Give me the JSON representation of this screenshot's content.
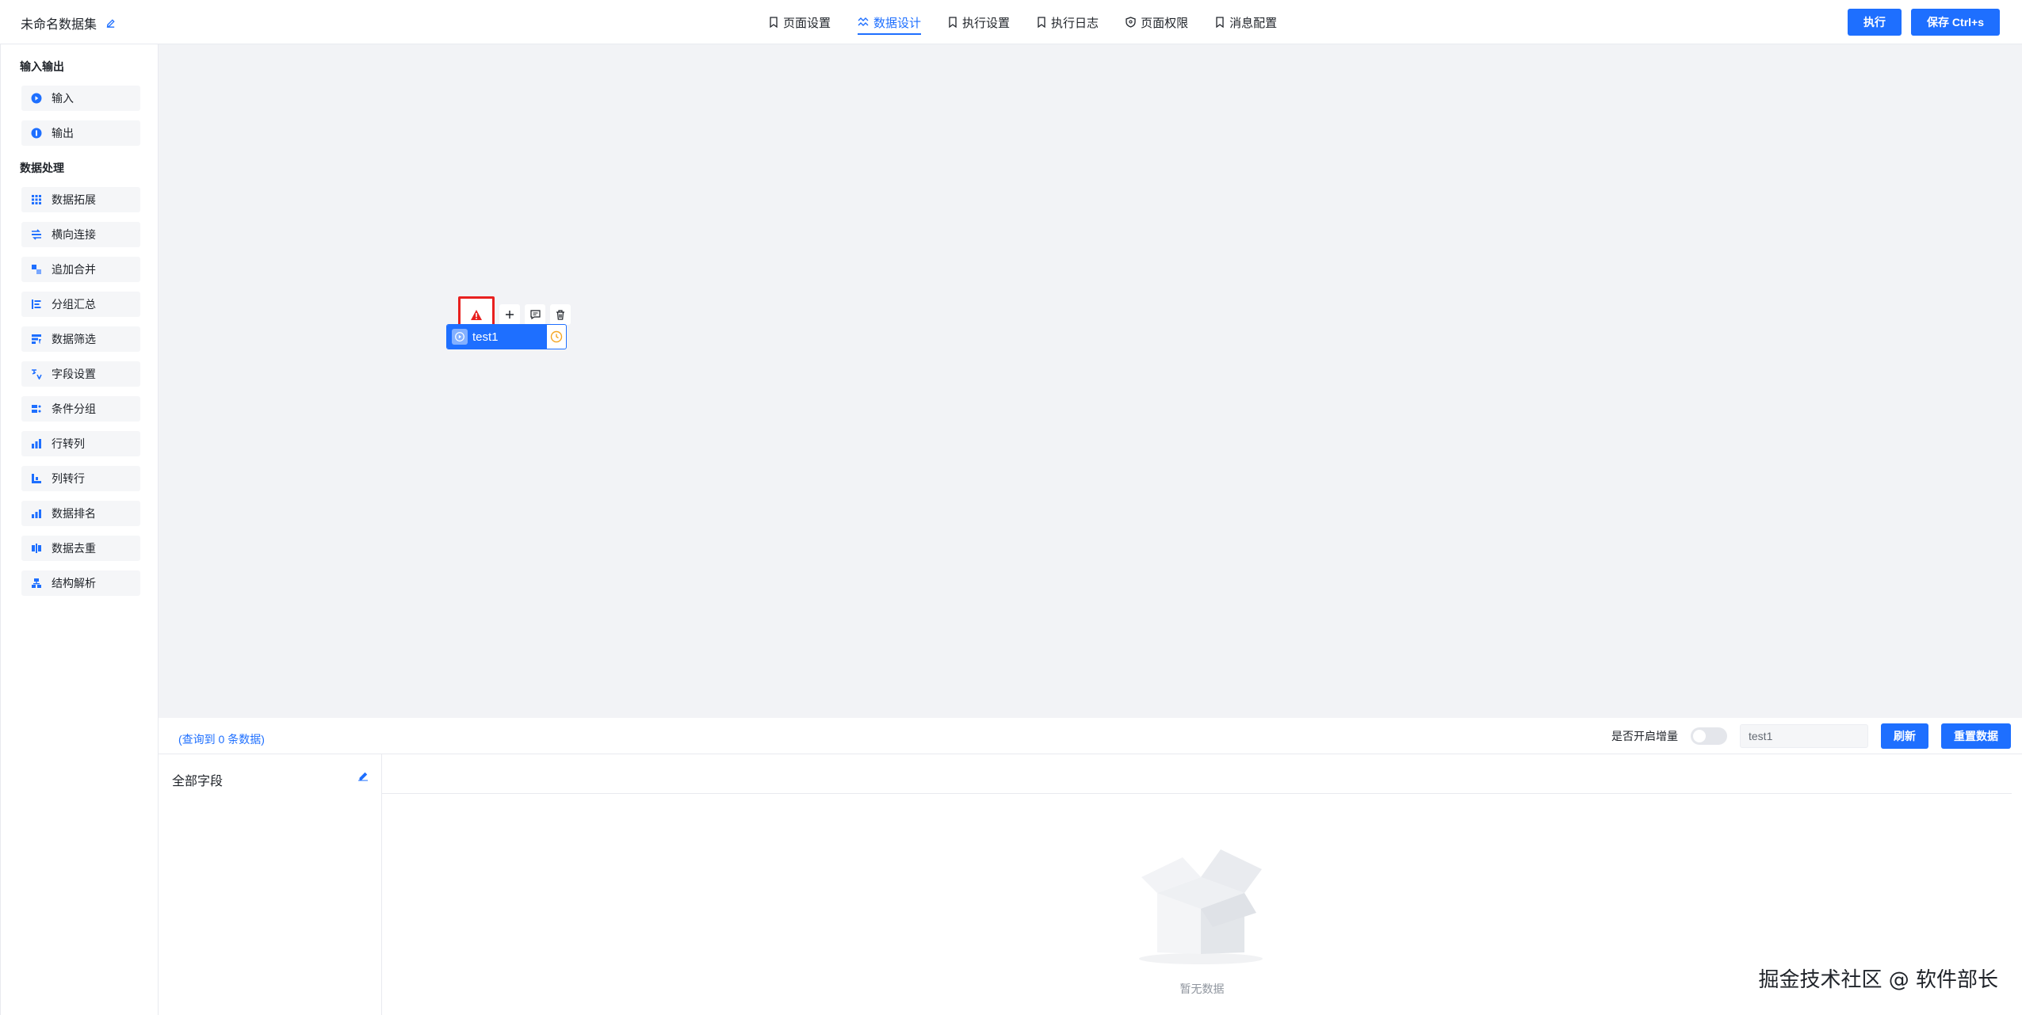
{
  "header": {
    "title": "未命名数据集",
    "tabs": [
      {
        "label": "页面设置",
        "icon": "bookmark-icon"
      },
      {
        "label": "数据设计",
        "icon": "design-icon",
        "active": true
      },
      {
        "label": "执行设置",
        "icon": "bookmark-icon"
      },
      {
        "label": "执行日志",
        "icon": "bookmark-icon"
      },
      {
        "label": "页面权限",
        "icon": "shield-icon"
      },
      {
        "label": "消息配置",
        "icon": "bookmark-icon"
      }
    ],
    "run_label": "执行",
    "save_label": "保存 Ctrl+s"
  },
  "sidebar": {
    "group_io": "输入输出",
    "io_items": [
      {
        "label": "输入",
        "icon": "input-icon"
      },
      {
        "label": "输出",
        "icon": "output-icon"
      }
    ],
    "group_process": "数据处理",
    "process_items": [
      {
        "label": "数据拓展",
        "icon": "grid-icon"
      },
      {
        "label": "横向连接",
        "icon": "join-icon"
      },
      {
        "label": "追加合并",
        "icon": "append-icon"
      },
      {
        "label": "分组汇总",
        "icon": "group-icon"
      },
      {
        "label": "数据筛选",
        "icon": "filter-icon"
      },
      {
        "label": "字段设置",
        "icon": "field-icon"
      },
      {
        "label": "条件分组",
        "icon": "condition-icon"
      },
      {
        "label": "行转列",
        "icon": "row-to-col-icon"
      },
      {
        "label": "列转行",
        "icon": "col-to-row-icon"
      },
      {
        "label": "数据排名",
        "icon": "rank-icon"
      },
      {
        "label": "数据去重",
        "icon": "dedupe-icon"
      },
      {
        "label": "结构解析",
        "icon": "structure-icon"
      }
    ]
  },
  "canvas": {
    "node_label": "test1"
  },
  "bottom": {
    "query_count": "(查询到 0 条数据)",
    "incremental_label": "是否开启增量",
    "node_select": "test1",
    "refresh_label": "刷新",
    "reset_label": "重置数据",
    "fields_title": "全部字段",
    "empty_text": "暂无数据"
  },
  "credit": "掘金技术社区 @ 软件部长",
  "colors": {
    "primary": "#1e6fff",
    "warning": "#e8201f",
    "canvas_bg": "#f2f3f6"
  }
}
